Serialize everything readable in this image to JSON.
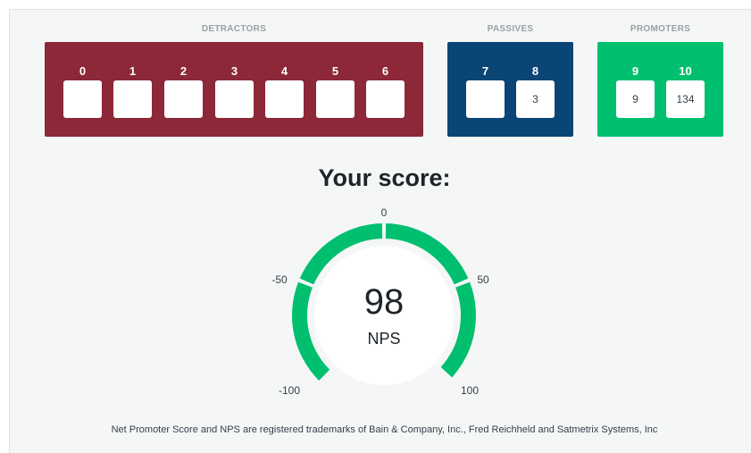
{
  "groups": {
    "detractors": "DETRACTORS",
    "passives": "PASSIVES",
    "promoters": "PROMOTERS"
  },
  "scale": [
    {
      "score": "0",
      "count": ""
    },
    {
      "score": "1",
      "count": ""
    },
    {
      "score": "2",
      "count": ""
    },
    {
      "score": "3",
      "count": ""
    },
    {
      "score": "4",
      "count": ""
    },
    {
      "score": "5",
      "count": ""
    },
    {
      "score": "6",
      "count": ""
    },
    {
      "score": "7",
      "count": ""
    },
    {
      "score": "8",
      "count": "3"
    },
    {
      "score": "9",
      "count": "9"
    },
    {
      "score": "10",
      "count": "134"
    }
  ],
  "score_title": "Your score:",
  "gauge": {
    "value": 98,
    "value_text": "98",
    "label": "NPS",
    "min": -100,
    "max": 100,
    "ticks": [
      "-100",
      "-50",
      "0",
      "50",
      "100"
    ]
  },
  "colors": {
    "detractors": "#8c2838",
    "passives": "#0a4576",
    "promoters": "#00bf6f",
    "gauge": "#00bf6f"
  },
  "footer": "Net Promoter Score and NPS are registered trademarks of Bain & Company, Inc., Fred Reichheld and Satmetrix Systems, Inc"
}
